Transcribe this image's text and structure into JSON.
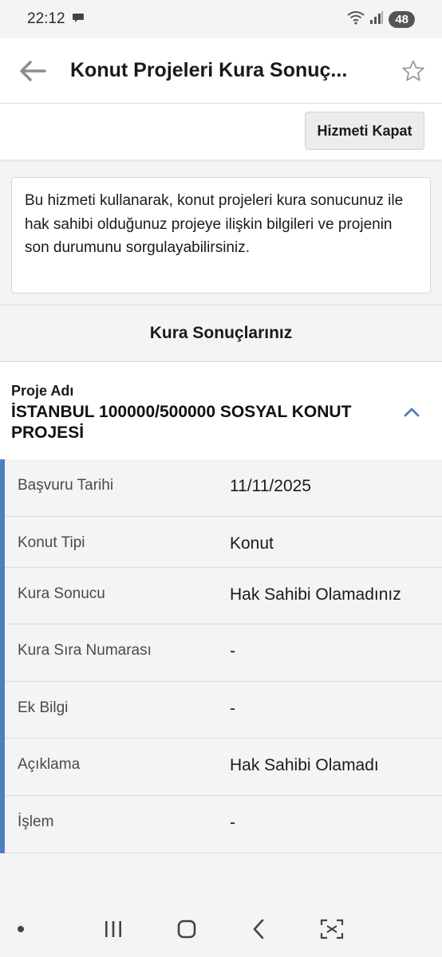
{
  "status": {
    "time": "22:12",
    "battery": "48"
  },
  "header": {
    "title": "Konut Projeleri Kura Sonuç..."
  },
  "toolbar": {
    "close_label": "Hizmeti Kapat"
  },
  "info": {
    "text": "Bu hizmeti kullanarak, konut projeleri kura sonucunuz ile hak sahibi olduğunuz projeye ilişkin bilgileri ve projenin son durumunu sorgulayabilirsiniz."
  },
  "results": {
    "heading": "Kura Sonuçlarınız",
    "project_label": "Proje Adı",
    "project_name": "İSTANBUL 100000/500000 SOSYAL KONUT PROJESİ",
    "rows": [
      {
        "label": "Başvuru Tarihi",
        "value": "11/11/2025"
      },
      {
        "label": "Konut Tipi",
        "value": "Konut"
      },
      {
        "label": "Kura Sonucu",
        "value": "Hak Sahibi Olamadınız"
      },
      {
        "label": "Kura Sıra Numarası",
        "value": "-"
      },
      {
        "label": "Ek Bilgi",
        "value": "-"
      },
      {
        "label": "Açıklama",
        "value": "Hak Sahibi Olamadı"
      },
      {
        "label": "İşlem",
        "value": "-"
      }
    ]
  },
  "colors": {
    "accent": "#4d7fbd"
  }
}
